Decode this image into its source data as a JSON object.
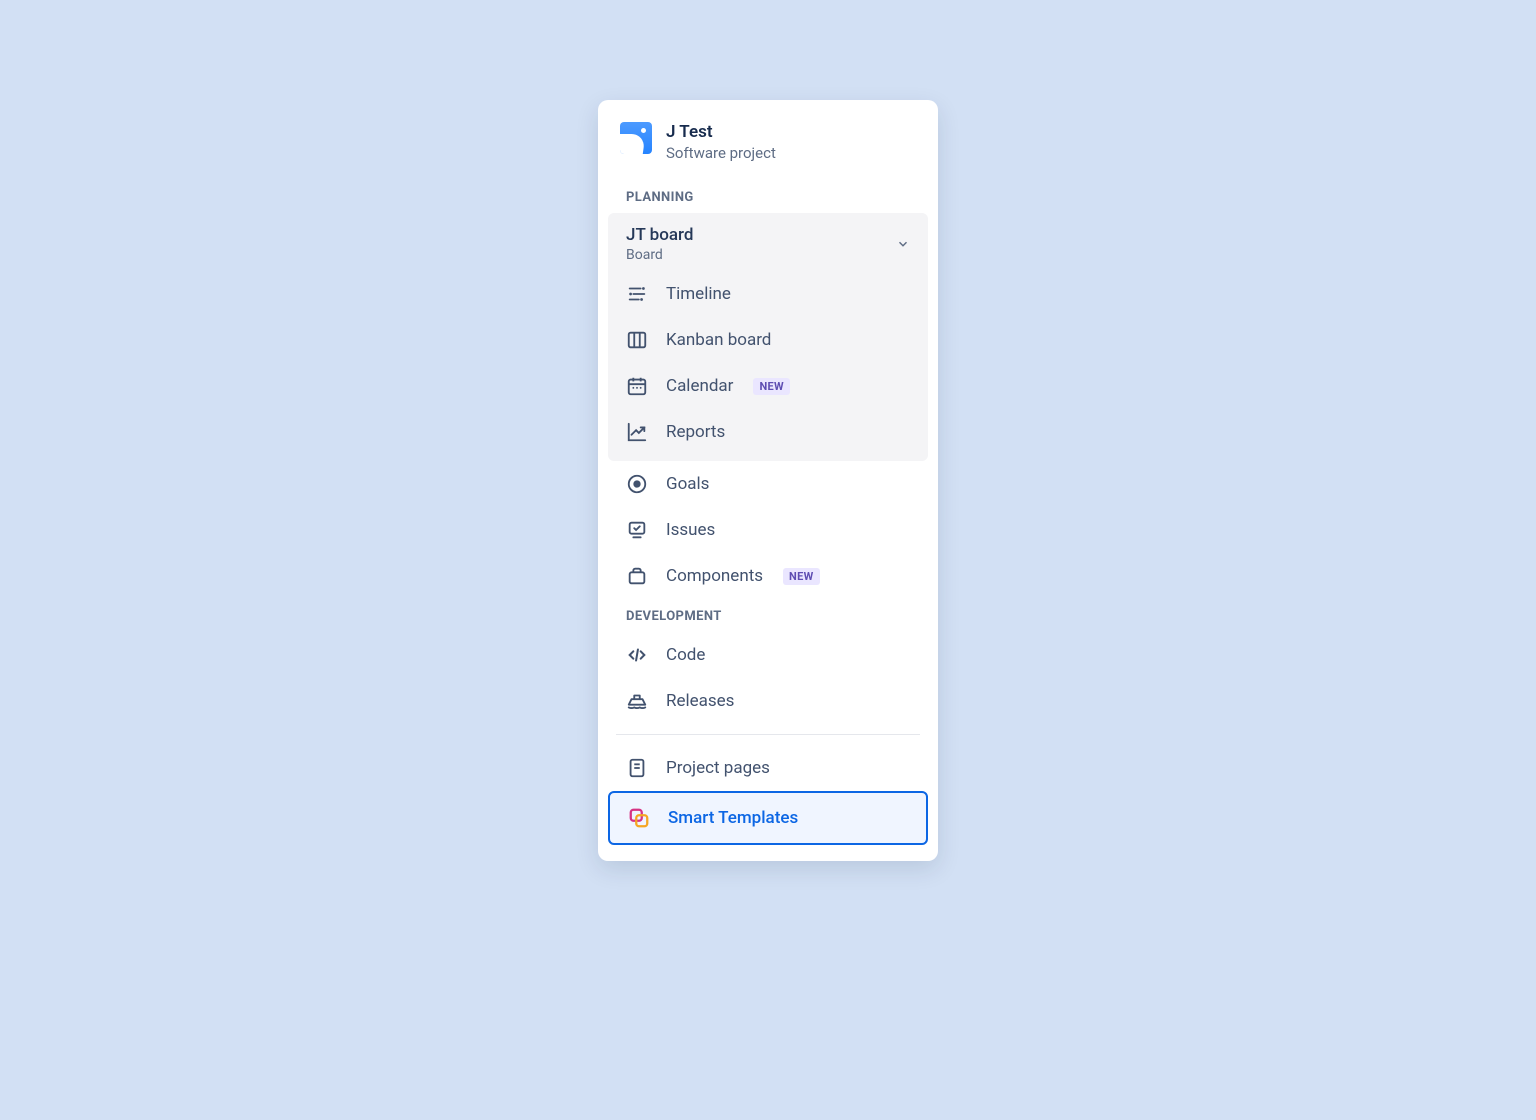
{
  "project": {
    "name": "J Test",
    "type": "Software project"
  },
  "sections": {
    "planning": "PLANNING",
    "development": "DEVELOPMENT"
  },
  "board": {
    "name": "JT board",
    "type": "Board",
    "items": {
      "timeline": "Timeline",
      "kanban": "Kanban board",
      "calendar": "Calendar",
      "reports": "Reports"
    }
  },
  "planning_items": {
    "goals": "Goals",
    "issues": "Issues",
    "components": "Components"
  },
  "development_items": {
    "code": "Code",
    "releases": "Releases"
  },
  "footer_items": {
    "project_pages": "Project pages",
    "smart_templates": "Smart Templates"
  },
  "badges": {
    "new": "NEW"
  }
}
